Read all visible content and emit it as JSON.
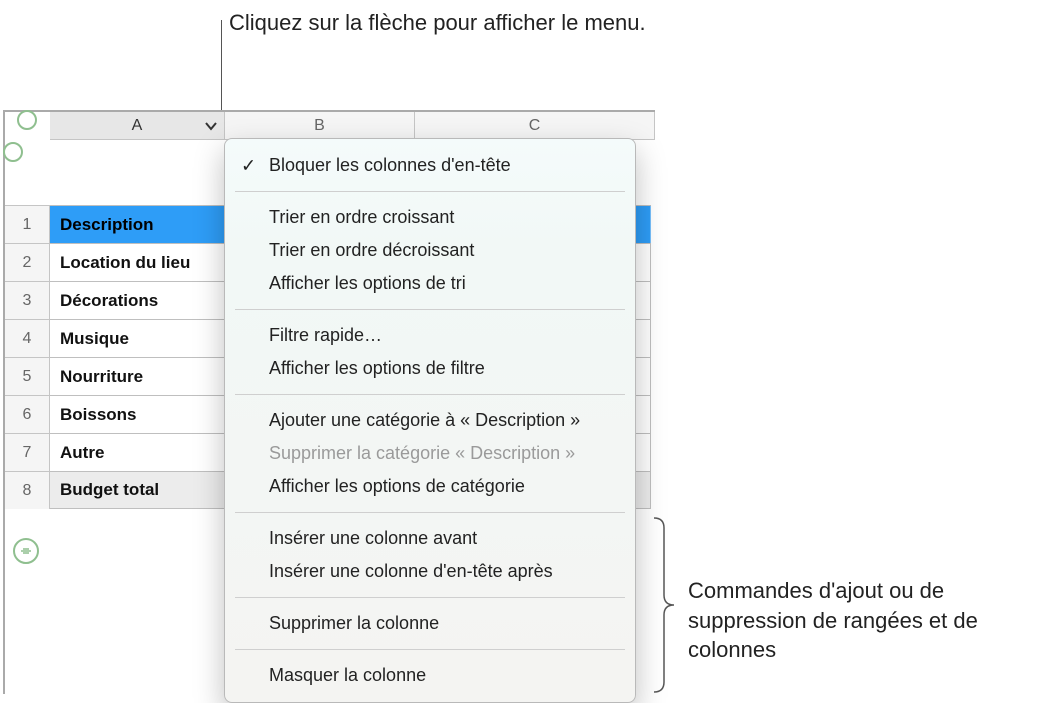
{
  "annotations": {
    "top": "Cliquez sur la flèche pour afficher le menu.",
    "right": "Commandes d'ajout ou de suppression de rangées et de colonnes"
  },
  "columns": {
    "A": "A",
    "B": "B",
    "C": "C"
  },
  "rows": [
    "1",
    "2",
    "3",
    "4",
    "5",
    "6",
    "7",
    "8"
  ],
  "table": {
    "header": "Description",
    "items": [
      "Location du lieu",
      "Décorations",
      "Musique",
      "Nourriture",
      "Boissons",
      "Autre"
    ],
    "footer": "Budget total"
  },
  "menu": {
    "lock": "Bloquer les colonnes d'en-tête",
    "sort_asc": "Trier en ordre croissant",
    "sort_desc": "Trier en ordre décroissant",
    "sort_opts": "Afficher les options de tri",
    "quick_filter": "Filtre rapide…",
    "filter_opts": "Afficher les options de filtre",
    "add_cat": "Ajouter une catégorie à « Description »",
    "del_cat": "Supprimer la catégorie « Description »",
    "cat_opts": "Afficher les options de catégorie",
    "ins_before": "Insérer une colonne avant",
    "ins_after": "Insérer une colonne d'en-tête après",
    "delete_col": "Supprimer la colonne",
    "hide_col": "Masquer la colonne"
  }
}
